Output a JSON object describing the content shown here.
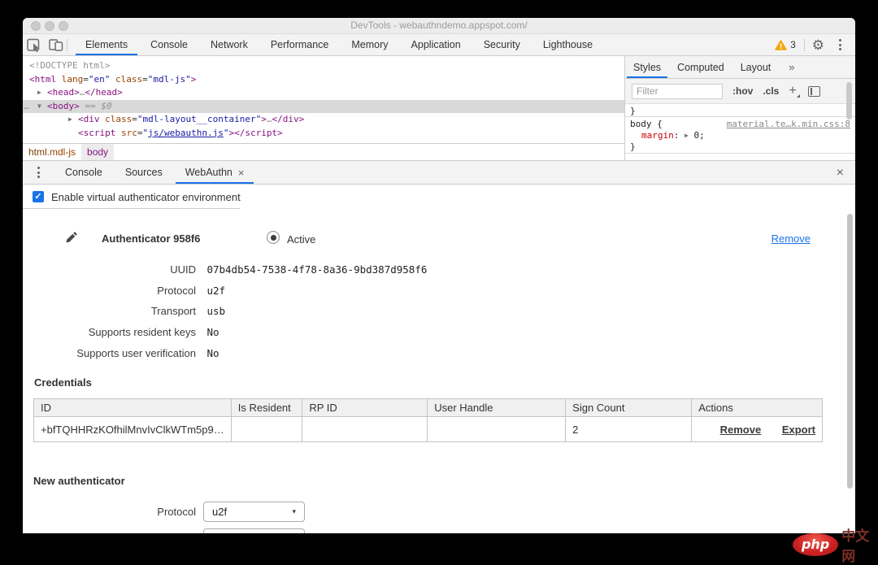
{
  "window": {
    "title": "DevTools - webauthndemo.appspot.com/"
  },
  "toolbar": {
    "tabs": [
      {
        "label": "Elements",
        "active": true
      },
      {
        "label": "Console"
      },
      {
        "label": "Network"
      },
      {
        "label": "Performance"
      },
      {
        "label": "Memory"
      },
      {
        "label": "Application"
      },
      {
        "label": "Security"
      },
      {
        "label": "Lighthouse"
      }
    ],
    "warning_count": "3"
  },
  "icons": {
    "close": "×",
    "gear": "⚙",
    "overflow": "»",
    "add": "+",
    "select_arrow": "▾",
    "check": "✓"
  },
  "elements_panel": {
    "dom_lines": [
      {
        "indent": 0,
        "arrow": "",
        "tokens": [
          [
            "gray",
            "<!DOCTYPE html>"
          ]
        ]
      },
      {
        "indent": 0,
        "arrow": "",
        "tokens": [
          [
            "tag",
            "<html"
          ],
          [
            "attr",
            " lang"
          ],
          [
            "plain",
            "="
          ],
          [
            "val",
            "\"en\""
          ],
          [
            "attr",
            " class"
          ],
          [
            "plain",
            "="
          ],
          [
            "val",
            "\"mdl-js\""
          ],
          [
            "tag",
            ">"
          ]
        ]
      },
      {
        "indent": 1,
        "arrow": "▶",
        "tokens": [
          [
            "tag",
            "<head>"
          ],
          [
            "gray",
            "…"
          ],
          [
            "tag",
            "</head>"
          ]
        ]
      },
      {
        "indent": 1,
        "arrow": "▼",
        "selected": true,
        "prefix": "…",
        "tokens": [
          [
            "tag",
            "<body>"
          ],
          [
            "meta",
            " == $0"
          ]
        ]
      },
      {
        "indent": 2,
        "arrow": "▶",
        "tokens": [
          [
            "tag",
            "<div"
          ],
          [
            "attr",
            " class"
          ],
          [
            "plain",
            "="
          ],
          [
            "val",
            "\"mdl-layout__container\""
          ],
          [
            "tag",
            ">"
          ],
          [
            "gray",
            "…"
          ],
          [
            "tag",
            "</div>"
          ]
        ]
      },
      {
        "indent": 2,
        "arrow": "",
        "tokens": [
          [
            "tag",
            "<script"
          ],
          [
            "attr",
            " src"
          ],
          [
            "plain",
            "="
          ],
          [
            "val",
            "\""
          ],
          [
            "link",
            "js/webauthn.js"
          ],
          [
            "val",
            "\""
          ],
          [
            "tag",
            ">"
          ],
          [
            "tag",
            "</script>"
          ]
        ]
      }
    ],
    "breadcrumbs": {
      "first_tag": "html",
      "first_class": ".mdl-js",
      "second": "body"
    }
  },
  "styles_panel": {
    "tabs": [
      {
        "label": "Styles",
        "active": true
      },
      {
        "label": "Computed"
      },
      {
        "label": "Layout"
      }
    ],
    "filter_placeholder": "Filter",
    "hov": ":hov",
    "cls": ".cls",
    "prev_close_brace": "}",
    "rule": {
      "selector": "body",
      "open_brace": "{",
      "source_link": "material.te…k.min.css:8",
      "property": "margin",
      "arrow": "▶",
      "value": "0;",
      "close_brace": "}"
    }
  },
  "drawer": {
    "tabs": [
      {
        "label": "Console"
      },
      {
        "label": "Sources"
      },
      {
        "label": "WebAuthn",
        "active": true
      }
    ],
    "webauthn": {
      "enable_label": "Enable virtual authenticator environment",
      "authenticator": {
        "name": "Authenticator 958f6",
        "state_label": "Active",
        "remove_label": "Remove",
        "fields": [
          {
            "label": "UUID",
            "value": "07b4db54-7538-4f78-8a36-9bd387d958f6"
          },
          {
            "label": "Protocol",
            "value": "u2f"
          },
          {
            "label": "Transport",
            "value": "usb"
          },
          {
            "label": "Supports resident keys",
            "value": "No"
          },
          {
            "label": "Supports user verification",
            "value": "No"
          }
        ]
      },
      "credentials": {
        "heading": "Credentials",
        "columns": [
          "ID",
          "Is Resident",
          "RP ID",
          "User Handle",
          "Sign Count",
          "Actions"
        ],
        "row": {
          "id": "+bfTQHHRzKOfhilMnvIvClkWTm5p9…",
          "is_resident": "",
          "rp_id": "",
          "user_handle": "",
          "sign_count": "2",
          "remove_label": "Remove",
          "export_label": "Export"
        }
      },
      "new_authenticator": {
        "heading": "New authenticator",
        "protocol_label": "Protocol",
        "protocol_value": "u2f"
      }
    }
  },
  "watermark": {
    "logo": "php",
    "site": "中文网"
  },
  "colors": {
    "accent_blue": "#1a73e8",
    "warning_yellow": "#f2a60d",
    "link_blue": "#1a73e8",
    "tag_purple": "#881280",
    "attr_orange": "#994500",
    "value_blue": "#1a1aa6",
    "property_red": "#c80000"
  }
}
